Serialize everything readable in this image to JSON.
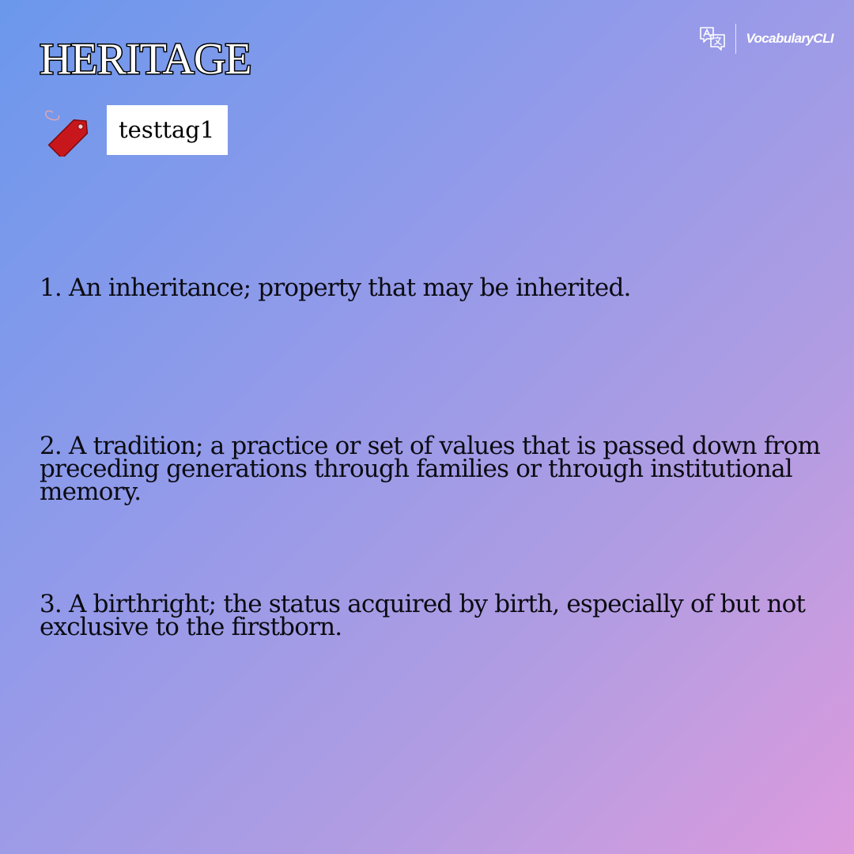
{
  "word": "HERITAGE",
  "tag": {
    "icon": "price-tag-icon",
    "label": "testtag1"
  },
  "brand": {
    "icon": "translate-icon",
    "name": "VocabularyCLI"
  },
  "definitions": [
    "1. An inheritance; property that may be inherited.",
    "2. A tradition; a practice or set of values that is passed down from preceding generations through families or through institutional memory.",
    "3. A birthright; the status acquired by birth, especially of but not exclusive to the firstborn."
  ],
  "colors": {
    "gradient_start": "#6b98ec",
    "gradient_end": "#dc9bdd",
    "tag_red": "#c8171c",
    "text": "#0b0b12"
  }
}
